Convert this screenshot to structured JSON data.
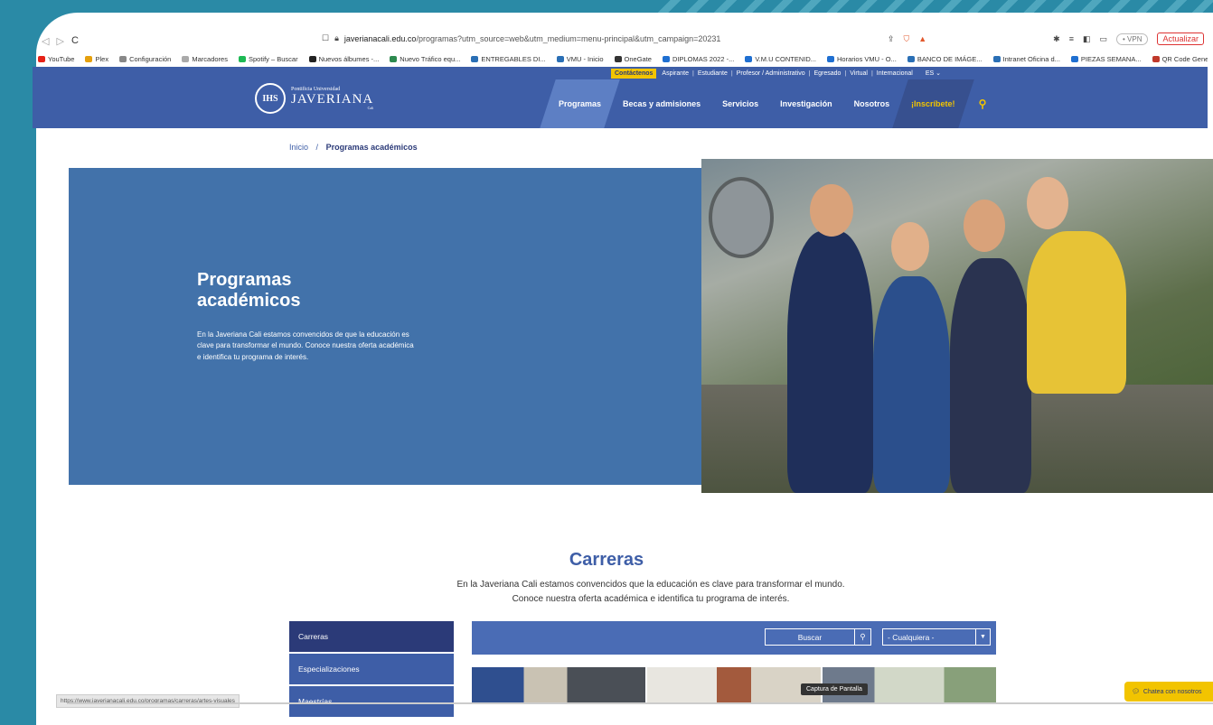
{
  "browser": {
    "url_host": "javerianacali.edu.co",
    "url_path": "/programas?utm_source=web&utm_medium=menu-principal&utm_campaign=20231",
    "vpn_label": "• VPN",
    "update_label": "Actualizar",
    "bookmarks": [
      {
        "label": "YouTube",
        "color": "#e62117"
      },
      {
        "label": "Plex",
        "color": "#e5a00d"
      },
      {
        "label": "Configuración",
        "color": "#888888"
      },
      {
        "label": "Marcadores",
        "color": "#aaaaaa"
      },
      {
        "label": "Spotify – Buscar",
        "color": "#1db954"
      },
      {
        "label": "Nuevos álbumes -...",
        "color": "#222222"
      },
      {
        "label": "Nuevo Tráfico equ...",
        "color": "#2d8a4f"
      },
      {
        "label": "ENTREGABLES DI...",
        "color": "#2a6fb5"
      },
      {
        "label": "VMU - Inicio",
        "color": "#2a6fb5"
      },
      {
        "label": "OneGate",
        "color": "#333333"
      },
      {
        "label": "DIPLOMAS 2022 -...",
        "color": "#1f6fd1"
      },
      {
        "label": "V.M.U CONTENID...",
        "color": "#1f6fd1"
      },
      {
        "label": "Horarios VMU - O...",
        "color": "#1f6fd1"
      },
      {
        "label": "BANCO DE IMÁGE...",
        "color": "#2a6fb5"
      },
      {
        "label": "Intranet Oficina d...",
        "color": "#2a6fb5"
      },
      {
        "label": "PIEZAS SEMANA...",
        "color": "#1f6fd1"
      },
      {
        "label": "QR Code Generator",
        "color": "#c0392b"
      }
    ],
    "status_url": "https://www.javerianacali.edu.co/programas/carreras/artes-visuales"
  },
  "site": {
    "topbar": {
      "contact": "Contáctenos",
      "links": [
        "Aspirante",
        "Estudiante",
        "Profesor / Administrativo",
        "Egresado",
        "Virtual",
        "Internacional"
      ],
      "lang": "ES ⌄"
    },
    "logo": {
      "small": "Pontificia Universidad",
      "big": "JAVERIANA",
      "seal": "IHS",
      "city": "Cali"
    },
    "nav": {
      "programas": "Programas",
      "becas": "Becas y admisiones",
      "servicios": "Servicios",
      "investigacion": "Investigación",
      "nosotros": "Nosotros",
      "inscribete": "¡Inscríbete!"
    },
    "breadcrumb": {
      "home": "Inicio",
      "sep": "/",
      "current": "Programas académicos"
    },
    "hero": {
      "title": "Programas académicos",
      "text": "En la Javeriana Cali estamos convencidos de que la educación es clave para transformar el mundo. Conoce nuestra oferta académica e identifica tu programa de interés."
    },
    "carreras": {
      "title": "Carreras",
      "desc": "En la Javeriana Cali estamos convencidos que la educación es clave para transformar el mundo. Conoce nuestra oferta académica e identifica tu programa de interés."
    },
    "side_menu": [
      "Carreras",
      "Especializaciones",
      "Maestrías"
    ],
    "filter": {
      "search_placeholder": "Buscar",
      "select_value": "- Cualquiera -"
    },
    "capture_label": "Captura de Pantalla",
    "chat_label": "Chatea con nosotros"
  },
  "colors": {
    "brand": "#3e5ea7",
    "accent": "#f2c400",
    "hero": "#4272aa",
    "frame": "#2a8aa6"
  }
}
